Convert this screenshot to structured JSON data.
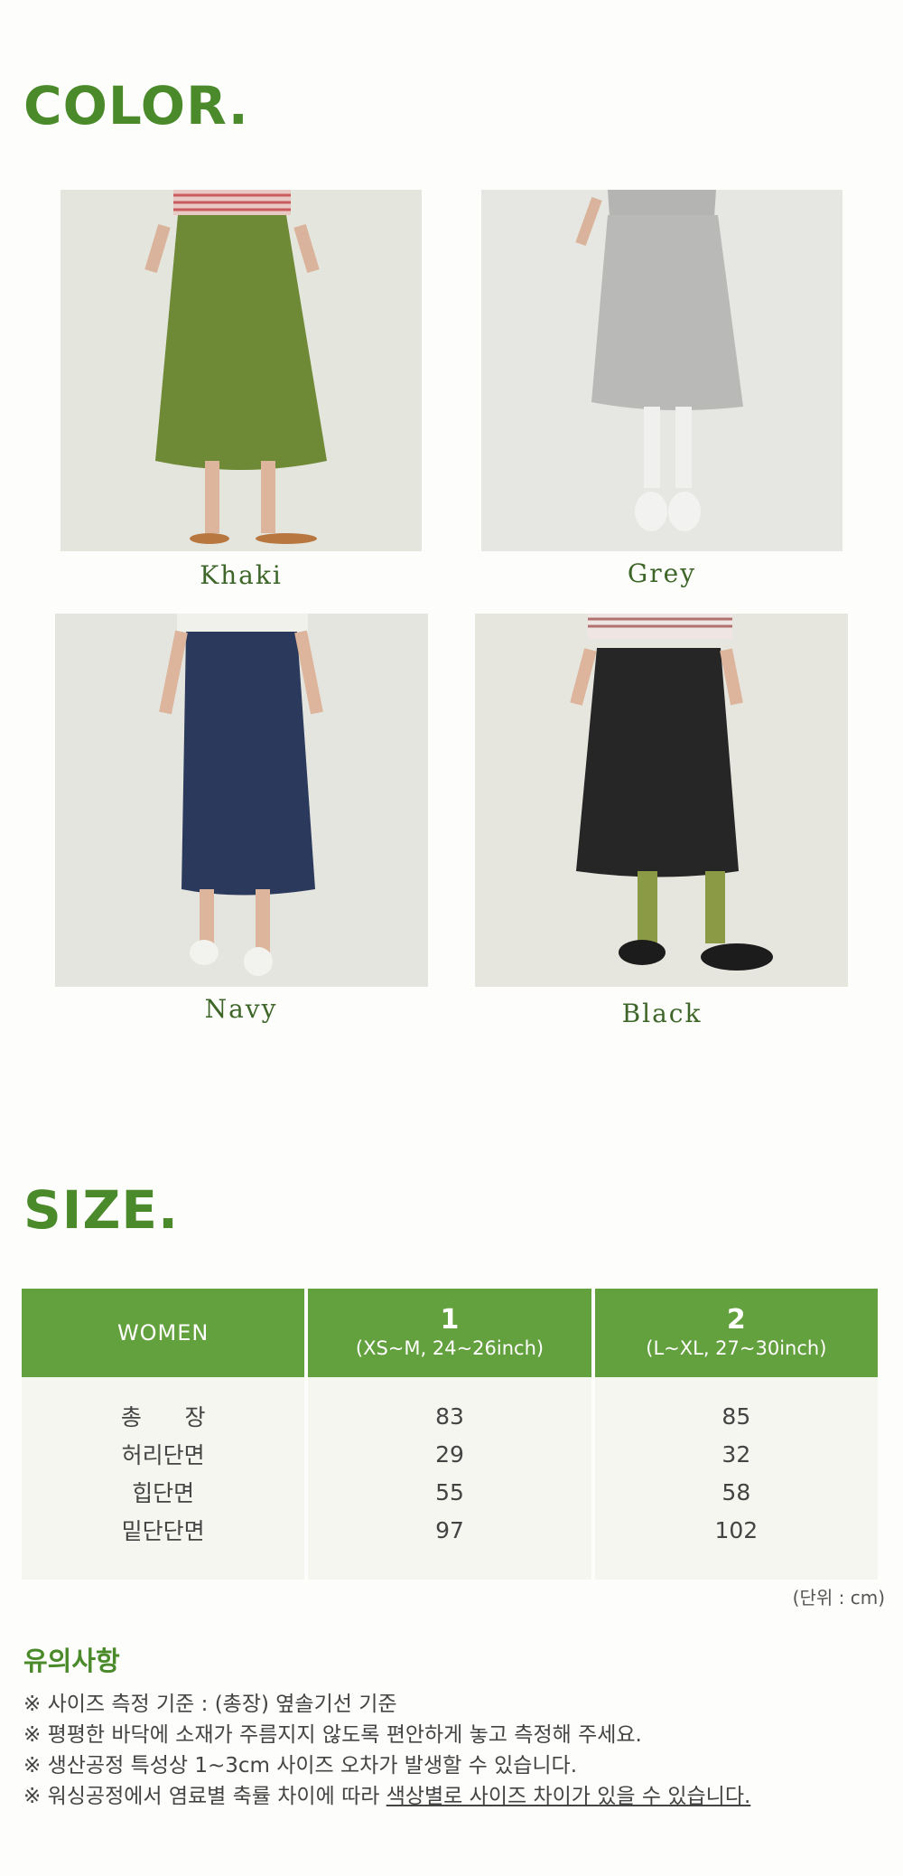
{
  "color_section": {
    "heading": "COLOR.",
    "colors": [
      {
        "name": "Khaki",
        "swatch": "#6f8a36"
      },
      {
        "name": "Grey",
        "swatch": "#b9b9b7"
      },
      {
        "name": "Navy",
        "swatch": "#2b3a5c"
      },
      {
        "name": "Black",
        "swatch": "#262626"
      }
    ]
  },
  "size_section": {
    "heading": "SIZE.",
    "table": {
      "header": {
        "women": "WOMEN",
        "size1_label": "1",
        "size1_range": "(XS~M, 24~26inch)",
        "size2_label": "2",
        "size2_range": "(L~XL, 27~30inch)"
      },
      "rows": [
        {
          "label": "총      장",
          "s1": "83",
          "s2": "85"
        },
        {
          "label": "허리단면",
          "s1": "29",
          "s2": "32"
        },
        {
          "label": "힙단면",
          "s1": "55",
          "s2": "58"
        },
        {
          "label": "밑단단면",
          "s1": "97",
          "s2": "102"
        }
      ]
    },
    "unit_note": "(단위 : cm)"
  },
  "notice": {
    "title": "유의사항",
    "lines": [
      "※ 사이즈 측정 기준 : (총장) 옆솔기선 기준",
      "※ 평평한 바닥에 소재가 주름지지 않도록 편안하게 놓고 측정해 주세요.",
      "※ 생산공정 특성상 1~3cm 사이즈 오차가 발생할 수 있습니다."
    ],
    "last_line_prefix": "※ 워싱공정에서 염료별 축률 차이에 따라 ",
    "last_line_underlined": "색상별로 사이즈 차이가 있을 수 있습니다."
  },
  "theme": {
    "accent": "#4a8a2a",
    "table_header_bg": "#63a03e",
    "table_body_bg": "#f4f6ef"
  }
}
